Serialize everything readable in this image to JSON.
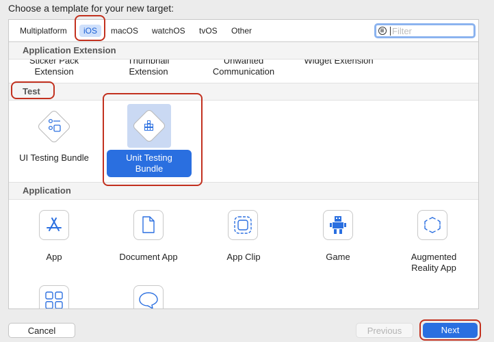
{
  "prompt": "Choose a template for your new target:",
  "tabs": [
    {
      "label": "Multiplatform"
    },
    {
      "label": "iOS",
      "selected": true
    },
    {
      "label": "macOS"
    },
    {
      "label": "watchOS"
    },
    {
      "label": "tvOS"
    },
    {
      "label": "Other"
    }
  ],
  "filter": {
    "placeholder": "Filter"
  },
  "sections": {
    "app_extension": "Application Extension",
    "test": "Test",
    "application": "Application"
  },
  "extension_tiles": [
    {
      "label": "Sticker Pack\nExtension"
    },
    {
      "label": "Thumbnail\nExtension"
    },
    {
      "label": "Unwanted\nCommunication"
    },
    {
      "label": "Widget Extension"
    }
  ],
  "test_tiles": [
    {
      "label": "UI Testing Bundle",
      "icon": "ui-testing-icon"
    },
    {
      "label": "Unit Testing\nBundle",
      "icon": "unit-testing-icon",
      "selected": true
    }
  ],
  "application_tiles": [
    {
      "label": "App",
      "icon": "app-store-icon"
    },
    {
      "label": "Document App",
      "icon": "document-icon"
    },
    {
      "label": "App Clip",
      "icon": "app-clip-icon"
    },
    {
      "label": "Game",
      "icon": "game-icon"
    },
    {
      "label": "Augmented\nReality App",
      "icon": "ar-icon"
    }
  ],
  "buttons": {
    "cancel": "Cancel",
    "previous": "Previous",
    "next": "Next"
  },
  "colors": {
    "accent": "#2a6fe0",
    "annotation": "#c2301e",
    "selected_tab_bg": "#cfe0fb"
  }
}
